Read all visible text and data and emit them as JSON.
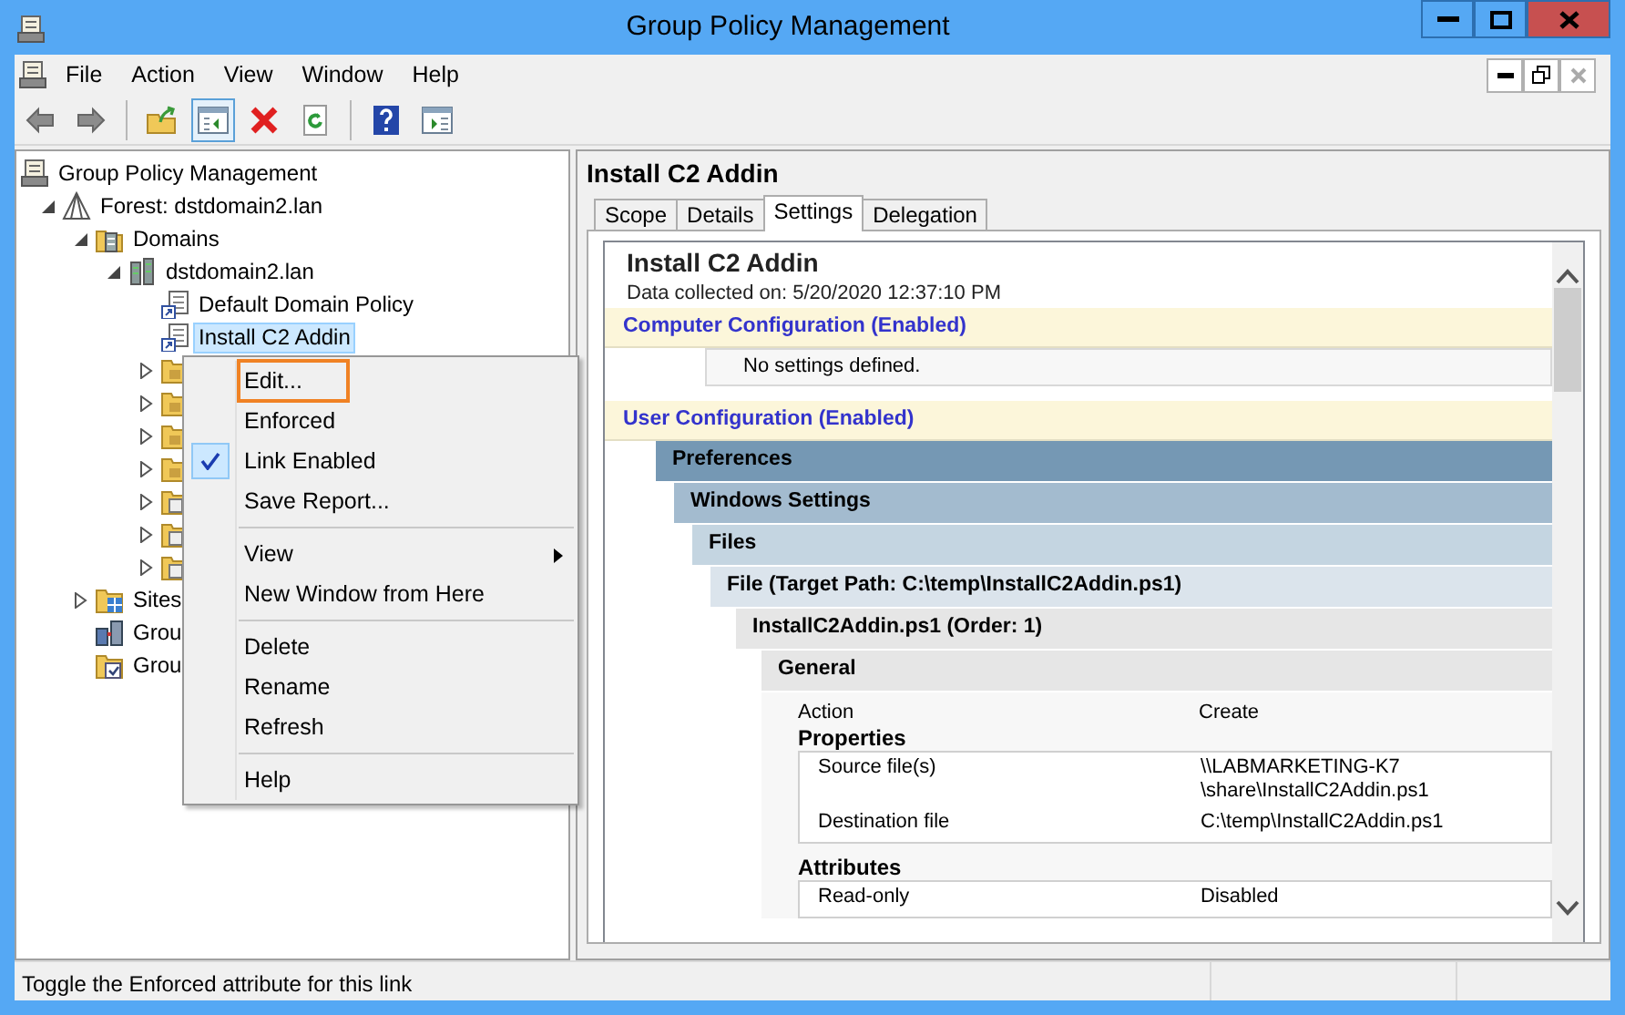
{
  "window": {
    "title": "Group Policy Management"
  },
  "menu_bar": [
    "File",
    "Action",
    "View",
    "Window",
    "Help"
  ],
  "toolbar": [
    {
      "kind": "back",
      "pressed": false
    },
    {
      "kind": "forward",
      "pressed": false
    },
    {
      "kind": "sep"
    },
    {
      "kind": "up",
      "pressed": false
    },
    {
      "kind": "tree",
      "pressed": true
    },
    {
      "kind": "delete",
      "pressed": false
    },
    {
      "kind": "refresh",
      "pressed": false
    },
    {
      "kind": "sep"
    },
    {
      "kind": "help",
      "pressed": false
    },
    {
      "kind": "pane",
      "pressed": false
    }
  ],
  "tree": [
    {
      "kind": "gpm",
      "label": "Group Policy Management",
      "selected": false,
      "children": [
        {
          "kind": "forest",
          "label": "Forest: dstdomain2.lan",
          "expanded": true,
          "selected": false,
          "children": [
            {
              "kind": "domains",
              "label": "Domains",
              "expanded": true,
              "selected": false,
              "children": [
                {
                  "kind": "domain",
                  "label": "dstdomain2.lan",
                  "expanded": true,
                  "selected": false,
                  "children": [
                    {
                      "kind": "link",
                      "label": "Default Domain Policy",
                      "selected": false
                    },
                    {
                      "kind": "link",
                      "label": "Install C2 Addin",
                      "selected": true
                    },
                    {
                      "kind": "ou",
                      "expanded": false,
                      "selected": false
                    },
                    {
                      "kind": "ou",
                      "expanded": false,
                      "selected": false
                    },
                    {
                      "kind": "ou",
                      "expanded": false,
                      "selected": false
                    },
                    {
                      "kind": "ou",
                      "expanded": false,
                      "selected": false
                    },
                    {
                      "kind": "folder",
                      "expanded": false,
                      "selected": false
                    },
                    {
                      "kind": "folder",
                      "expanded": false,
                      "selected": false
                    },
                    {
                      "kind": "folder",
                      "expanded": false,
                      "selected": false
                    }
                  ]
                }
              ]
            },
            {
              "kind": "sites",
              "label": "Sites",
              "expanded": false,
              "selected": false
            },
            {
              "kind": "modeling",
              "label": "Grou",
              "selected": false
            },
            {
              "kind": "results",
              "label": "Grou",
              "selected": false
            }
          ]
        }
      ]
    }
  ],
  "context_menu": [
    {
      "kind": "item",
      "label": "Edit...",
      "selected": true,
      "checked": false,
      "submenu": false
    },
    {
      "kind": "item",
      "label": "Enforced",
      "selected": false,
      "checked": false,
      "submenu": false
    },
    {
      "kind": "item",
      "label": "Link Enabled",
      "selected": false,
      "checked": true,
      "submenu": false
    },
    {
      "kind": "item",
      "label": "Save Report...",
      "selected": false,
      "checked": false,
      "submenu": false
    },
    {
      "kind": "separator"
    },
    {
      "kind": "item",
      "label": "View",
      "selected": false,
      "checked": false,
      "submenu": true
    },
    {
      "kind": "item",
      "label": "New Window from Here",
      "selected": false,
      "checked": false,
      "submenu": false
    },
    {
      "kind": "separator"
    },
    {
      "kind": "item",
      "label": "Delete",
      "selected": false,
      "checked": false,
      "submenu": false
    },
    {
      "kind": "item",
      "label": "Rename",
      "selected": false,
      "checked": false,
      "submenu": false
    },
    {
      "kind": "item",
      "label": "Refresh",
      "selected": false,
      "checked": false,
      "submenu": false
    },
    {
      "kind": "separator"
    },
    {
      "kind": "item",
      "label": "Help",
      "selected": false,
      "checked": false,
      "submenu": false
    }
  ],
  "details": {
    "title": "Install C2 Addin",
    "tabs": [
      {
        "label": "Scope",
        "selected": false
      },
      {
        "label": "Details",
        "selected": false
      },
      {
        "label": "Settings",
        "selected": true
      },
      {
        "label": "Delegation",
        "selected": false
      }
    ],
    "report": {
      "title": "Install C2 Addin",
      "collected": "Data collected on: 5/20/2020 12:37:10 PM",
      "computer": {
        "label": "Computer Configuration (Enabled)",
        "note": "No settings defined."
      },
      "user": {
        "label": "User Configuration (Enabled)",
        "children": [
          {
            "label": "Preferences",
            "children": [
              {
                "label": "Windows Settings",
                "children": [
                  {
                    "label": "Files",
                    "children": [
                      {
                        "label": "File (Target Path: C:\\temp\\InstallC2Addin.ps1)",
                        "children": [
                          {
                            "label": "InstallC2Addin.ps1 (Order: 1)",
                            "children": [
                              {
                                "label": "General",
                                "body": [
                                  {
                                    "kind": "pair",
                                    "label": "Action",
                                    "value": "Create"
                                  },
                                  {
                                    "kind": "group",
                                    "title": "Properties",
                                    "rows": [
                                      {
                                        "label": "Source file(s)",
                                        "value_lines": [
                                          "\\\\LABMARKETING-K7",
                                          "\\share\\InstallC2Addin.ps1"
                                        ]
                                      },
                                      {
                                        "label": "Destination file",
                                        "value_lines": [
                                          "C:\\temp\\InstallC2Addin.ps1"
                                        ]
                                      }
                                    ]
                                  },
                                  {
                                    "kind": "group",
                                    "title": "Attributes",
                                    "rows": [
                                      {
                                        "label": "Read-only",
                                        "value_lines": [
                                          "Disabled"
                                        ]
                                      }
                                    ]
                                  }
                                ]
                              }
                            ]
                          }
                        ]
                      }
                    ]
                  }
                ]
              }
            ]
          }
        ]
      }
    }
  },
  "status_bar": "Toggle the Enforced attribute for this link"
}
